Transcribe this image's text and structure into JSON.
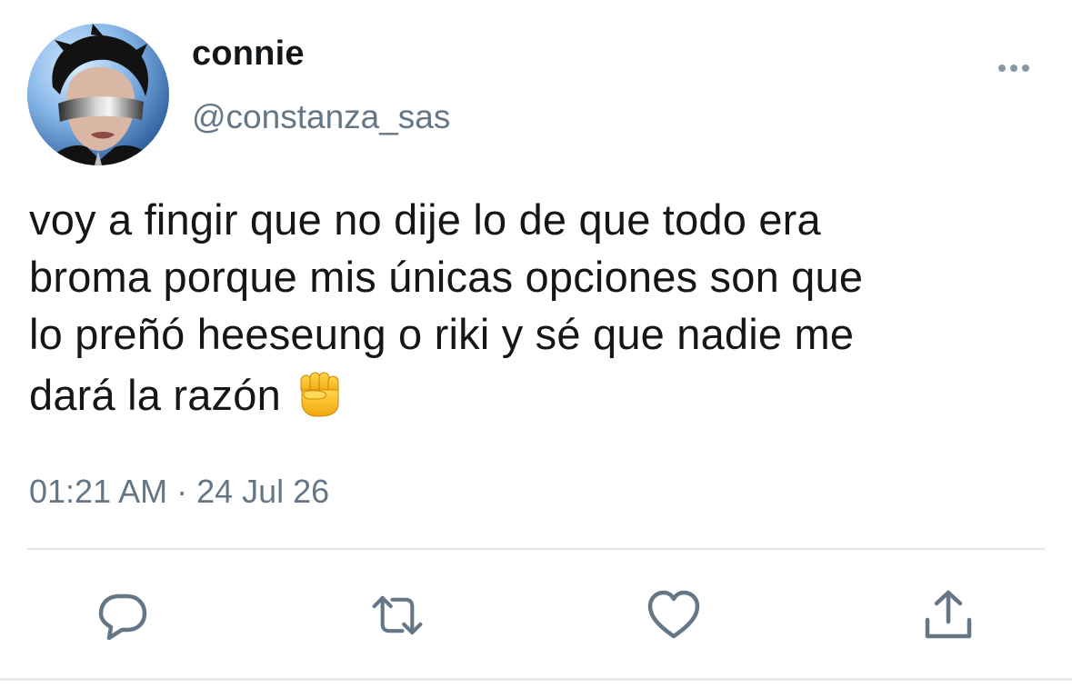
{
  "tweet": {
    "author": {
      "display_name": "connie",
      "handle": "@constanza_sas"
    },
    "text_lines": [
      "voy a fingir que no dije lo de que todo era",
      "broma porque mis únicas opciones son que",
      "lo preñó heeseung o riki y sé que nadie me",
      "dará la razón"
    ],
    "emoji": "raised-fist-emoji",
    "timestamp": "01:21 AM · 24 Jul 26"
  },
  "actions": {
    "reply_icon": "reply-icon",
    "retweet_icon": "retweet-icon",
    "like_icon": "heart-icon",
    "share_icon": "share-icon",
    "more_icon": "more-dots-icon"
  },
  "colors": {
    "text": "#14171a",
    "secondary": "#657786",
    "icon": "#657786",
    "divider": "#e1e8ed"
  }
}
